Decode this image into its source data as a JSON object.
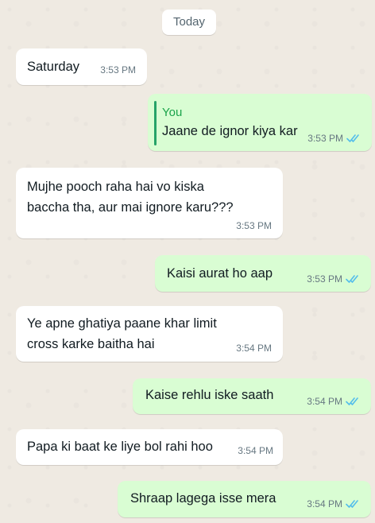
{
  "date_divider": "Today",
  "messages": [
    {
      "direction": "in",
      "text": "Saturday",
      "time": "3:53 PM"
    },
    {
      "direction": "out",
      "quote_author": "You",
      "text": "Jaane de ignor kiya kar",
      "time": "3:53 PM",
      "status": "read"
    },
    {
      "direction": "in",
      "text": "Mujhe pooch raha hai vo kiska\nbaccha tha, aur mai ignore karu???",
      "time": "3:53 PM"
    },
    {
      "direction": "out",
      "text": "Kaisi aurat ho aap",
      "time": "3:53 PM",
      "status": "read"
    },
    {
      "direction": "in",
      "text": "Ye apne ghatiya paane khar limit\ncross karke baitha hai",
      "time": "3:54 PM"
    },
    {
      "direction": "out",
      "text": "Kaise rehlu iske saath",
      "time": "3:54 PM",
      "status": "read"
    },
    {
      "direction": "in",
      "text": "Papa ki baat ke liye bol rahi hoo",
      "time": "3:54 PM"
    },
    {
      "direction": "out",
      "text": "Shraap lagega isse mera",
      "time": "3:54 PM",
      "status": "read"
    }
  ],
  "colors": {
    "background": "#efeae2",
    "incoming_bubble": "#ffffff",
    "outgoing_bubble": "#d9fdd3",
    "read_ticks": "#53bdeb",
    "quote_accent": "#25a368"
  },
  "icons": {
    "read_status": "double-check-icon"
  }
}
